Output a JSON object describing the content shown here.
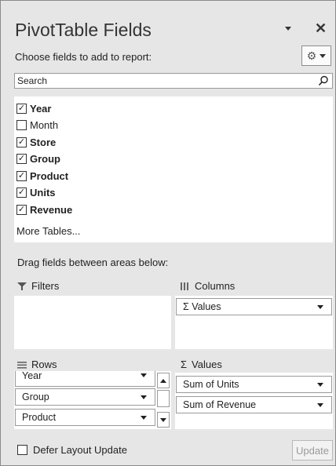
{
  "pane": {
    "title": "PivotTable Fields",
    "subtitle": "Choose fields to add to report:"
  },
  "search": {
    "placeholder": "Search"
  },
  "fields": [
    {
      "label": "Year",
      "checked": true
    },
    {
      "label": "Month",
      "checked": false
    },
    {
      "label": "Store",
      "checked": true
    },
    {
      "label": "Group",
      "checked": true
    },
    {
      "label": "Product",
      "checked": true
    },
    {
      "label": "Units",
      "checked": true
    },
    {
      "label": "Revenue",
      "checked": true
    }
  ],
  "more_tables": "More Tables...",
  "drag_label": "Drag fields between areas below:",
  "areas": {
    "filters": {
      "label": "Filters"
    },
    "columns": {
      "label": "Columns",
      "items": [
        "Σ Values"
      ]
    },
    "rows": {
      "label": "Rows",
      "items": [
        "Year",
        "Group",
        "Product"
      ]
    },
    "values": {
      "label": "Values",
      "items": [
        "Sum of Units",
        "Sum of Revenue"
      ]
    }
  },
  "footer": {
    "defer_label": "Defer Layout Update",
    "defer_checked": false,
    "update_label": "Update"
  },
  "icons": {
    "check": "✓",
    "sigma": "Σ"
  }
}
